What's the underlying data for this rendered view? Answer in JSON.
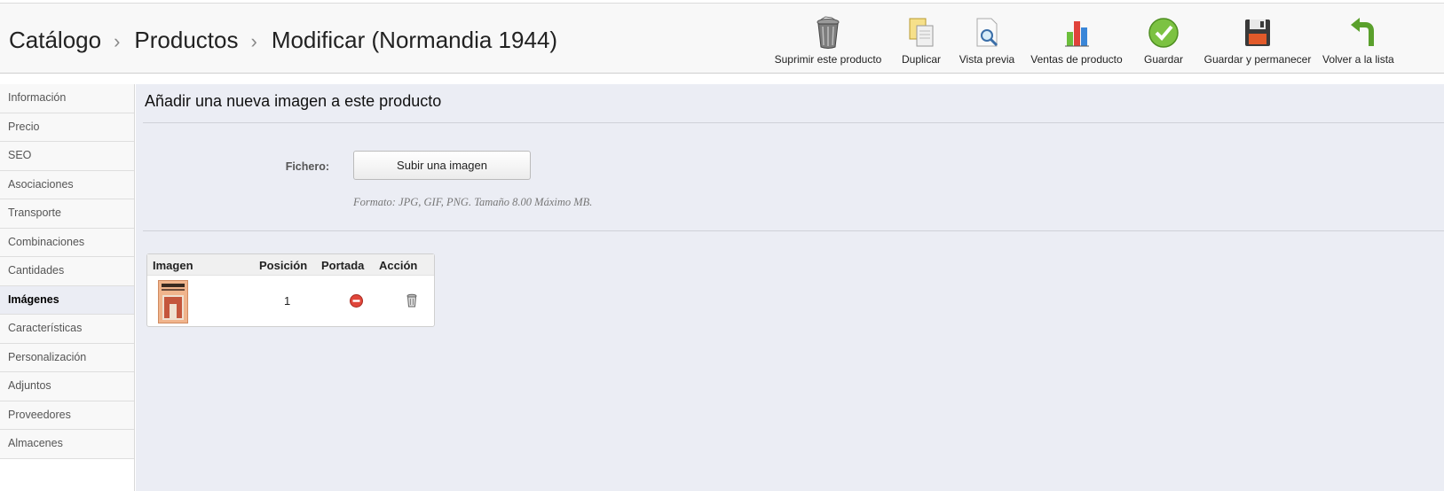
{
  "breadcrumb": {
    "items": [
      "Catálogo",
      "Productos",
      "Modificar (Normandia 1944)"
    ],
    "separator": "›"
  },
  "toolbar": {
    "delete_label": "Suprimir este producto",
    "duplicate_label": "Duplicar",
    "preview_label": "Vista previa",
    "sales_label": "Ventas de producto",
    "save_label": "Guardar",
    "save_stay_label": "Guardar y permanecer",
    "back_label": "Volver a la lista"
  },
  "sidebar": {
    "items": [
      {
        "label": "Información"
      },
      {
        "label": "Precio"
      },
      {
        "label": "SEO"
      },
      {
        "label": "Asociaciones"
      },
      {
        "label": "Transporte"
      },
      {
        "label": "Combinaciones"
      },
      {
        "label": "Cantidades"
      },
      {
        "label": "Imágenes",
        "active": true
      },
      {
        "label": "Características"
      },
      {
        "label": "Personalización"
      },
      {
        "label": "Adjuntos"
      },
      {
        "label": "Proveedores"
      },
      {
        "label": "Almacenes"
      }
    ]
  },
  "main": {
    "title": "Añadir una nueva imagen a este producto",
    "file_label": "Fichero:",
    "upload_button": "Subir una imagen",
    "format_note": "Formato: JPG, GIF, PNG. Tamaño 8.00 Máximo MB."
  },
  "images_table": {
    "headers": {
      "image": "Imagen",
      "position": "Posición",
      "cover": "Portada",
      "action": "Acción"
    },
    "rows": [
      {
        "position": "1",
        "cover_icon": "not-cover-icon",
        "action_icon": "delete-icon"
      }
    ]
  },
  "colors": {
    "main_bg": "#ebedf4",
    "header_bg": "#f8f8f8",
    "save_green": "#7cc242",
    "cover_red": "#e0463a"
  }
}
